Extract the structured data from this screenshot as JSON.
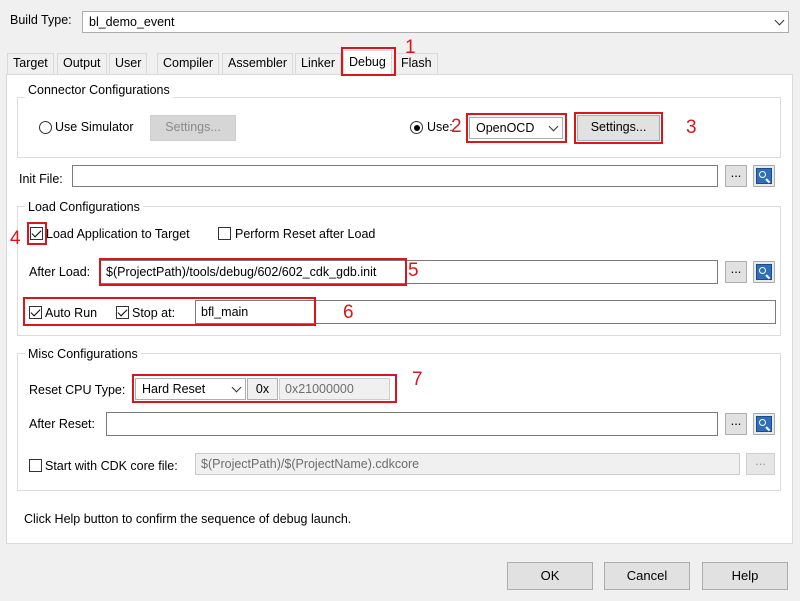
{
  "build_type": {
    "label": "Build Type:",
    "value": "bl_demo_event"
  },
  "tabs": [
    {
      "label": "Target"
    },
    {
      "label": "Output"
    },
    {
      "label": "User"
    },
    {
      "label": "Compiler"
    },
    {
      "label": "Assembler"
    },
    {
      "label": "Linker"
    },
    {
      "label": "Debug",
      "active": true
    },
    {
      "label": "Flash"
    }
  ],
  "connector": {
    "title": "Connector Configurations",
    "use_simulator_label": "Use Simulator",
    "simulator_settings_label": "Settings...",
    "use_label": "Use:",
    "debugger_value": "OpenOCD",
    "settings_label": "Settings..."
  },
  "init_file": {
    "label": "Init File:",
    "value": "",
    "browse_label": "..."
  },
  "load": {
    "title": "Load Configurations",
    "load_app_label": "Load Application to Target",
    "load_app_checked": true,
    "perform_reset_label": "Perform Reset after Load",
    "perform_reset_checked": false,
    "after_load_label": "After Load:",
    "after_load_value": "$(ProjectPath)/tools/debug/602/602_cdk_gdb.init",
    "browse_label": "...",
    "auto_run_label": "Auto Run",
    "auto_run_checked": true,
    "stop_at_label": "Stop at:",
    "stop_at_checked": true,
    "stop_at_value": "bfl_main"
  },
  "misc": {
    "title": "Misc Configurations",
    "reset_cpu_label": "Reset CPU Type:",
    "reset_cpu_value": "Hard Reset",
    "hex_prefix": "0x",
    "address_value": "0x21000000",
    "after_reset_label": "After Reset:",
    "after_reset_value": "",
    "browse_label": "...",
    "cdk_core_label": "Start with CDK core file:",
    "cdk_core_checked": false,
    "cdk_core_value": "$(ProjectPath)/$(ProjectName).cdkcore"
  },
  "help_text": "Click Help button to confirm the sequence of debug launch.",
  "buttons": {
    "ok": "OK",
    "cancel": "Cancel",
    "help": "Help"
  },
  "annotations": [
    "1",
    "2",
    "3",
    "4",
    "5",
    "6",
    "7"
  ],
  "colors": {
    "annotation": "#d9161c",
    "lookup_icon": "#2d6fb8"
  }
}
